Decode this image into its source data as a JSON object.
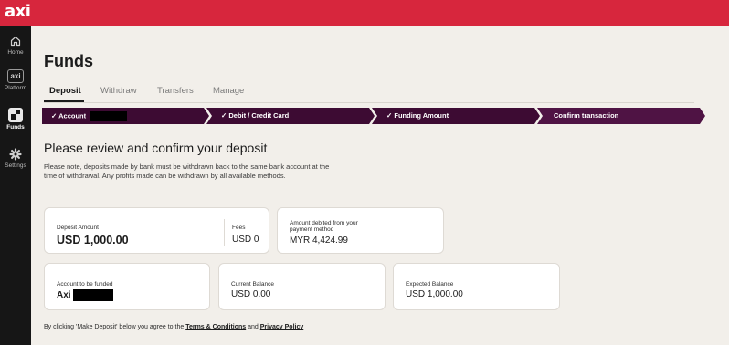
{
  "app": {
    "logo_text": "axi",
    "brand_color": "#d7263d",
    "sidebar_bg": "#161616",
    "stepper_color": "#3d0b33"
  },
  "sidebar": {
    "items": [
      {
        "label": "Home",
        "icon": "home-icon"
      },
      {
        "label": "Platform",
        "icon": "axi-platform-icon",
        "icon_text": "axi"
      },
      {
        "label": "Funds",
        "icon": "funds-icon",
        "active": true
      },
      {
        "label": "Settings",
        "icon": "gear-icon"
      }
    ]
  },
  "page": {
    "title": "Funds"
  },
  "tabs": [
    {
      "label": "Deposit",
      "active": true
    },
    {
      "label": "Withdraw"
    },
    {
      "label": "Transfers"
    },
    {
      "label": "Manage"
    }
  ],
  "stepper": {
    "steps": [
      {
        "label": "Account",
        "done": true,
        "check": "✓"
      },
      {
        "label": "Debit / Credit Card",
        "done": true,
        "check": "✓"
      },
      {
        "label": "Funding Amount",
        "done": true,
        "check": "✓"
      },
      {
        "label": "Confirm transaction",
        "done": false,
        "current": true
      }
    ]
  },
  "review": {
    "heading": "Please review and confirm your deposit",
    "note": "Please note, deposits made by bank must be withdrawn back to the same bank account at the time of withdrawal. Any profits made can be withdrawn by all available methods."
  },
  "summary": {
    "deposit_amount_label": "Deposit Amount",
    "deposit_amount_value": "USD 1,000.00",
    "fees_label": "Fees",
    "fees_value": "USD 0",
    "debited_label_line1": "Amount debited from your",
    "debited_label_line2": "payment method",
    "debited_value": "MYR 4,424.99",
    "account_label": "Account to be funded",
    "account_value": "Axi",
    "current_balance_label": "Current Balance",
    "current_balance_value": "USD 0.00",
    "expected_balance_label": "Expected Balance",
    "expected_balance_value": "USD 1,000.00"
  },
  "agreement": {
    "prefix": "By clicking 'Make Deposit' below you agree to the ",
    "terms_link": "Terms & Conditions",
    "middle": " and ",
    "privacy_link": "Privacy Policy"
  }
}
